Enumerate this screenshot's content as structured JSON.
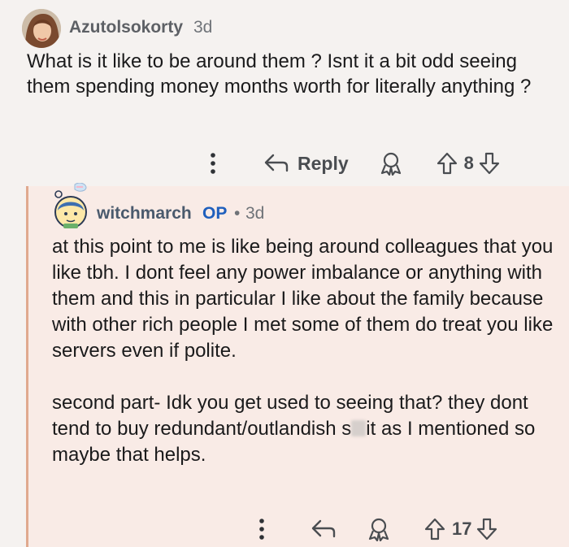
{
  "comment": {
    "username": "Azutolsokorty",
    "age": "3d",
    "body": "What is it like to be around them ? Isnt it a bit odd seeing them spending money months worth for literally anything ?",
    "reply_label": "Reply",
    "score": "8"
  },
  "reply": {
    "username": "witchmarch",
    "op_badge": "OP",
    "separator": "•",
    "age": "3d",
    "paragraph1": "at this point to me is like being around colleagues that you like tbh. I dont feel any power imbalance or anything with them and this in particular I like about the family because with other rich people I met some of them do treat you like servers even if polite.",
    "paragraph2_before": "second part- Idk you get used to seeing that? they dont tend to buy redundant/outlandish s",
    "paragraph2_after": "it as I mentioned so maybe that helps.",
    "score": "17"
  },
  "icons": {
    "more": "more-vertical-icon",
    "reply": "reply-arrow-icon",
    "award": "award-icon",
    "upvote": "upvote-icon",
    "downvote": "downvote-icon"
  },
  "colors": {
    "reply_background": "#f9ebe6",
    "thread_line": "#e0a98f",
    "op_badge": "#1f5fbd"
  }
}
